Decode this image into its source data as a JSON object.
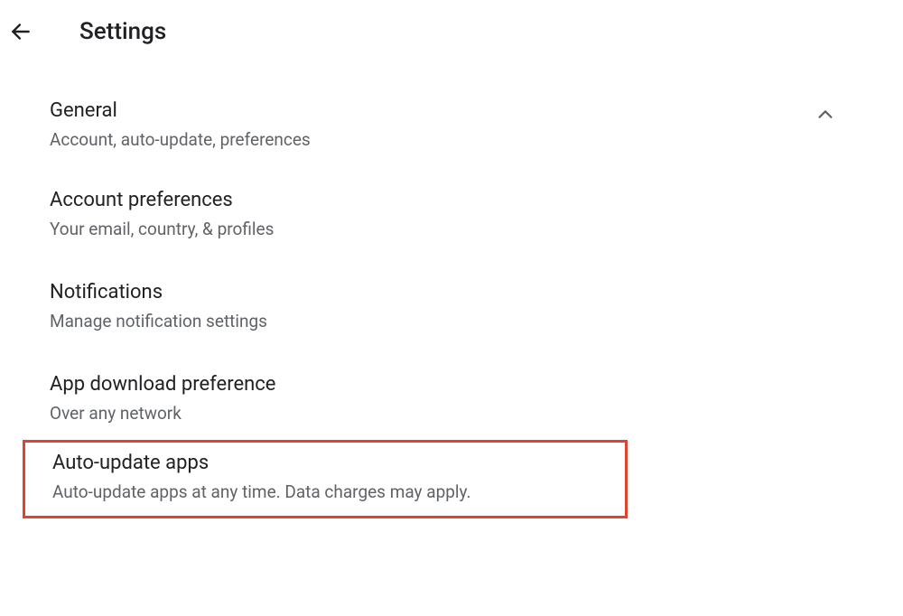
{
  "header": {
    "title": "Settings"
  },
  "section": {
    "title": "General",
    "subtitle": "Account, auto-update, preferences"
  },
  "items": [
    {
      "title": "Account preferences",
      "subtitle": "Your email, country, & profiles"
    },
    {
      "title": "Notifications",
      "subtitle": "Manage notification settings"
    },
    {
      "title": "App download preference",
      "subtitle": "Over any network"
    },
    {
      "title": "Auto-update apps",
      "subtitle": "Auto-update apps at any time. Data charges may apply."
    }
  ]
}
